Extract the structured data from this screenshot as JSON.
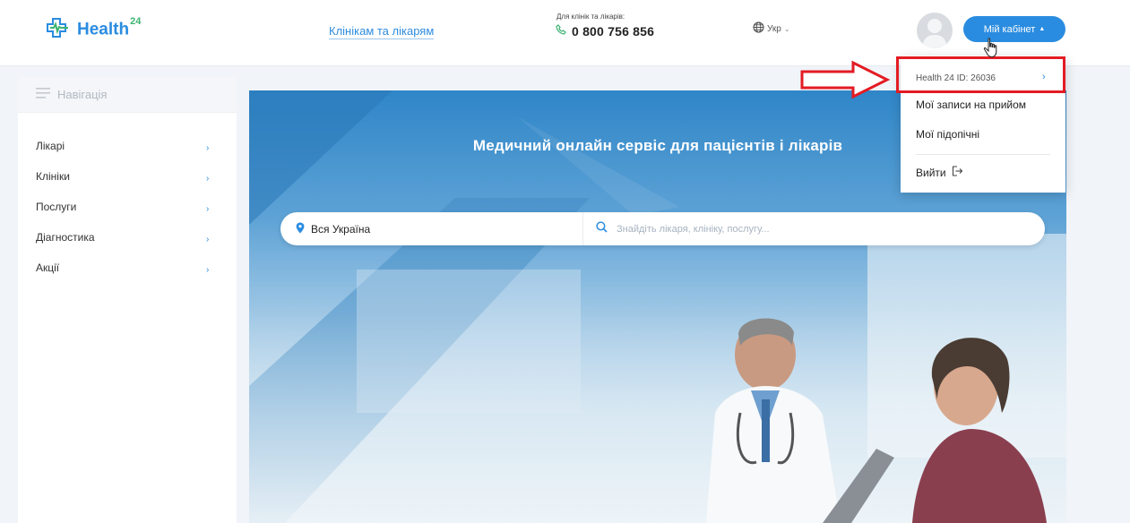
{
  "header": {
    "logo_text": "Health",
    "logo_sup": "24",
    "nav_link": "Клінікам та лікарям",
    "phone_caption": "Для клінік та лікарів:",
    "phone_number": "0 800 756 856",
    "language": "Укр",
    "cabinet_button": "Мій кабінет"
  },
  "sidebar": {
    "title": "Навігація",
    "items": [
      {
        "label": "Лікарі"
      },
      {
        "label": "Клініки"
      },
      {
        "label": "Послуги"
      },
      {
        "label": "Діагностика"
      },
      {
        "label": "Акції"
      }
    ]
  },
  "hero": {
    "title": "Медичний онлайн сервіс для пацієнтів і лікарів",
    "region": "Вся Україна",
    "search_placeholder": "Знайдіть лікаря, клініку, послугу..."
  },
  "dropdown": {
    "id_label": "Health 24 ID: 26036",
    "items": [
      "Мої записи на прийом",
      "Мої підопічні"
    ],
    "logout": "Вийти"
  },
  "colors": {
    "accent": "#2a8ce0",
    "annotation": "#e31b23"
  },
  "icons": [
    "logo-cross-icon",
    "phone-icon",
    "globe-icon",
    "chevron-down-icon",
    "chevron-up-icon",
    "hamburger-icon",
    "chevron-right-icon",
    "location-pin-icon",
    "search-icon",
    "logout-icon",
    "hand-cursor-icon"
  ]
}
